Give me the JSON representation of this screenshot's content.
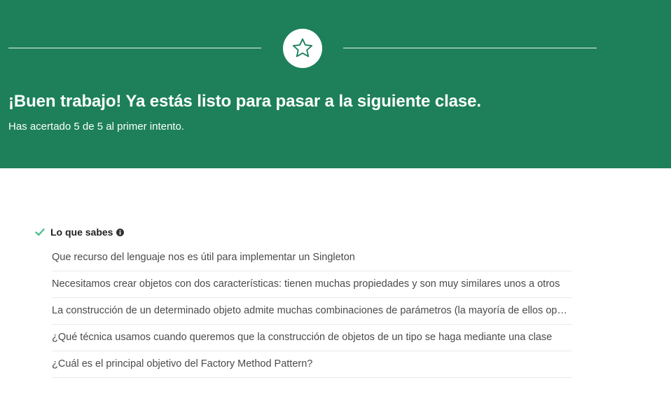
{
  "banner": {
    "title": "¡Buen trabajo! Ya estás listo para pasar a la siguiente clase.",
    "subtitle": "Has acertado 5 de 5 al primer intento.",
    "badge_icon": "star-icon",
    "background_color": "#1d805a"
  },
  "section": {
    "header": "Lo que sabes",
    "status_icon": "check-icon",
    "info_icon": "info-icon",
    "accent_color": "#4fc08d",
    "questions": [
      "Que recurso del lenguaje nos es útil para implementar un Singleton",
      "Necesitamos crear objetos con dos características: tienen muchas propiedades y son muy similares unos a otros",
      "La construcción de un determinado objeto admite muchas combinaciones de parámetros (la mayoría de ellos opcionales)",
      "¿Qué técnica usamos cuando queremos que la construcción de objetos de un tipo se haga mediante una clase",
      "¿Cuál es el principal objetivo del Factory Method Pattern?"
    ]
  }
}
